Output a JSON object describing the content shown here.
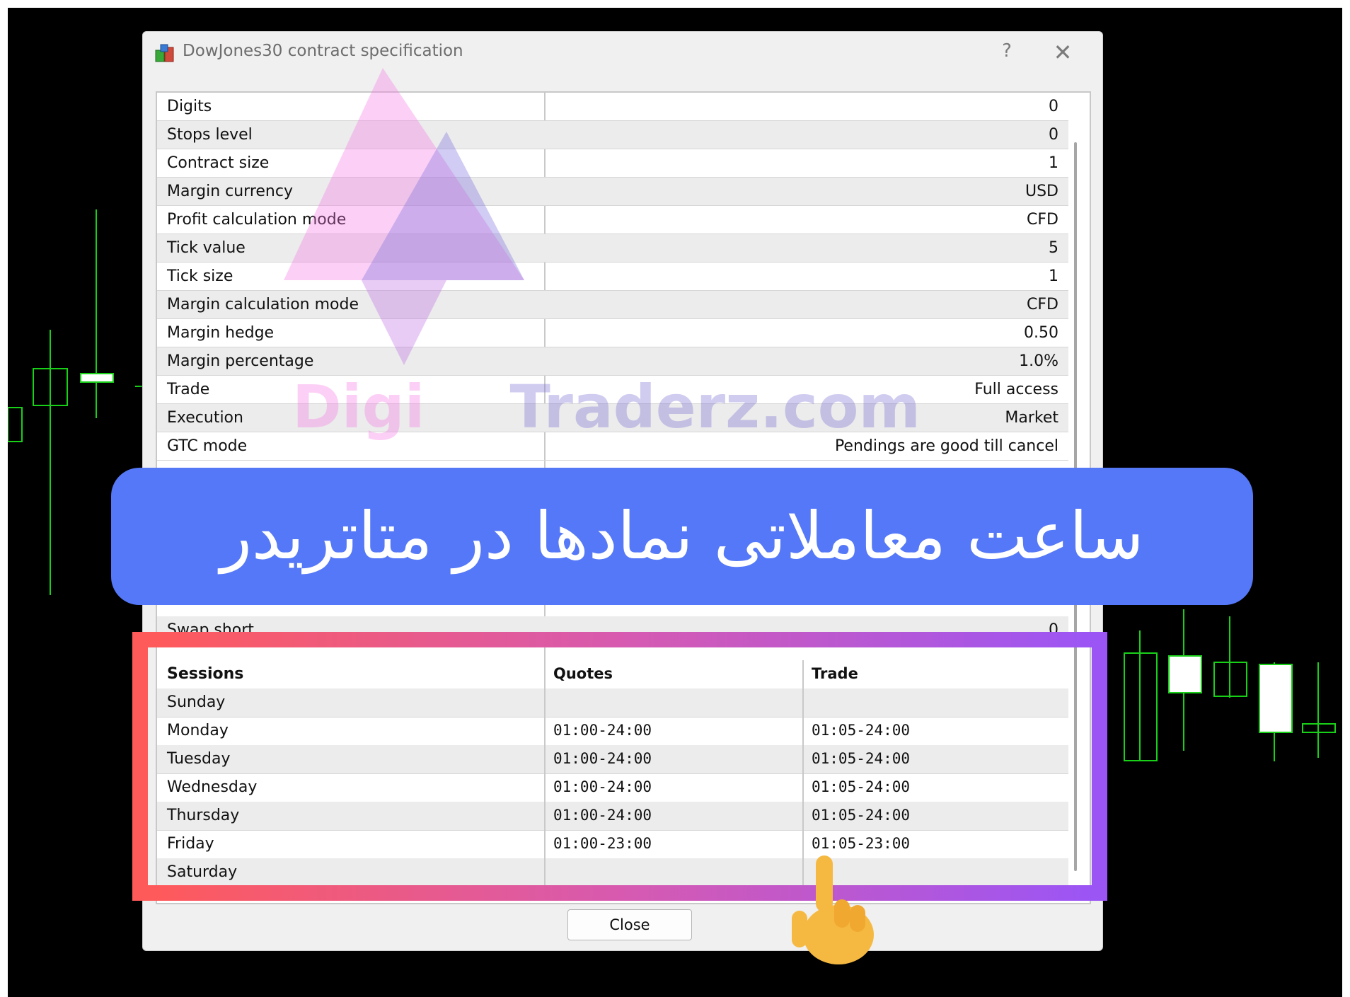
{
  "dialog": {
    "title": "DowJones30 contract specification",
    "help_label": "?",
    "close_icon_label": "✕",
    "close_button_label": "Close"
  },
  "properties": [
    {
      "key": "Digits",
      "value": "0"
    },
    {
      "key": "Stops level",
      "value": "0"
    },
    {
      "key": "Contract size",
      "value": "1"
    },
    {
      "key": "Margin currency",
      "value": "USD"
    },
    {
      "key": "Profit calculation mode",
      "value": "CFD"
    },
    {
      "key": "Tick value",
      "value": "5"
    },
    {
      "key": "Tick size",
      "value": "1"
    },
    {
      "key": "Margin calculation mode",
      "value": "CFD"
    },
    {
      "key": "Margin hedge",
      "value": "0.50"
    },
    {
      "key": "Margin percentage",
      "value": "1.0%"
    },
    {
      "key": "Trade",
      "value": "Full access"
    },
    {
      "key": "Execution",
      "value": "Market"
    },
    {
      "key": "GTC mode",
      "value": "Pendings are good till cancel"
    },
    {
      "key": "Swap short",
      "value": "0"
    }
  ],
  "sessions": {
    "headers": [
      "Sessions",
      "Quotes",
      "Trade"
    ],
    "rows": [
      {
        "day": "Sunday",
        "quotes": "",
        "trade": ""
      },
      {
        "day": "Monday",
        "quotes": "01:00-24:00",
        "trade": "01:05-24:00"
      },
      {
        "day": "Tuesday",
        "quotes": "01:00-24:00",
        "trade": "01:05-24:00"
      },
      {
        "day": "Wednesday",
        "quotes": "01:00-24:00",
        "trade": "01:05-24:00"
      },
      {
        "day": "Thursday",
        "quotes": "01:00-24:00",
        "trade": "01:05-24:00"
      },
      {
        "day": "Friday",
        "quotes": "01:00-23:00",
        "trade": "01:05-23:00"
      },
      {
        "day": "Saturday",
        "quotes": "",
        "trade": ""
      }
    ]
  },
  "watermark": {
    "part1": "Digi",
    "part2": "Traderz.com"
  },
  "banner": {
    "text": "ساعت معاملاتی نمادها در متاتریدر"
  },
  "colors": {
    "banner": "#5478f7",
    "highlight_start": "#ff5a5a",
    "highlight_end": "#9b55f5",
    "candles": "#00e000"
  }
}
